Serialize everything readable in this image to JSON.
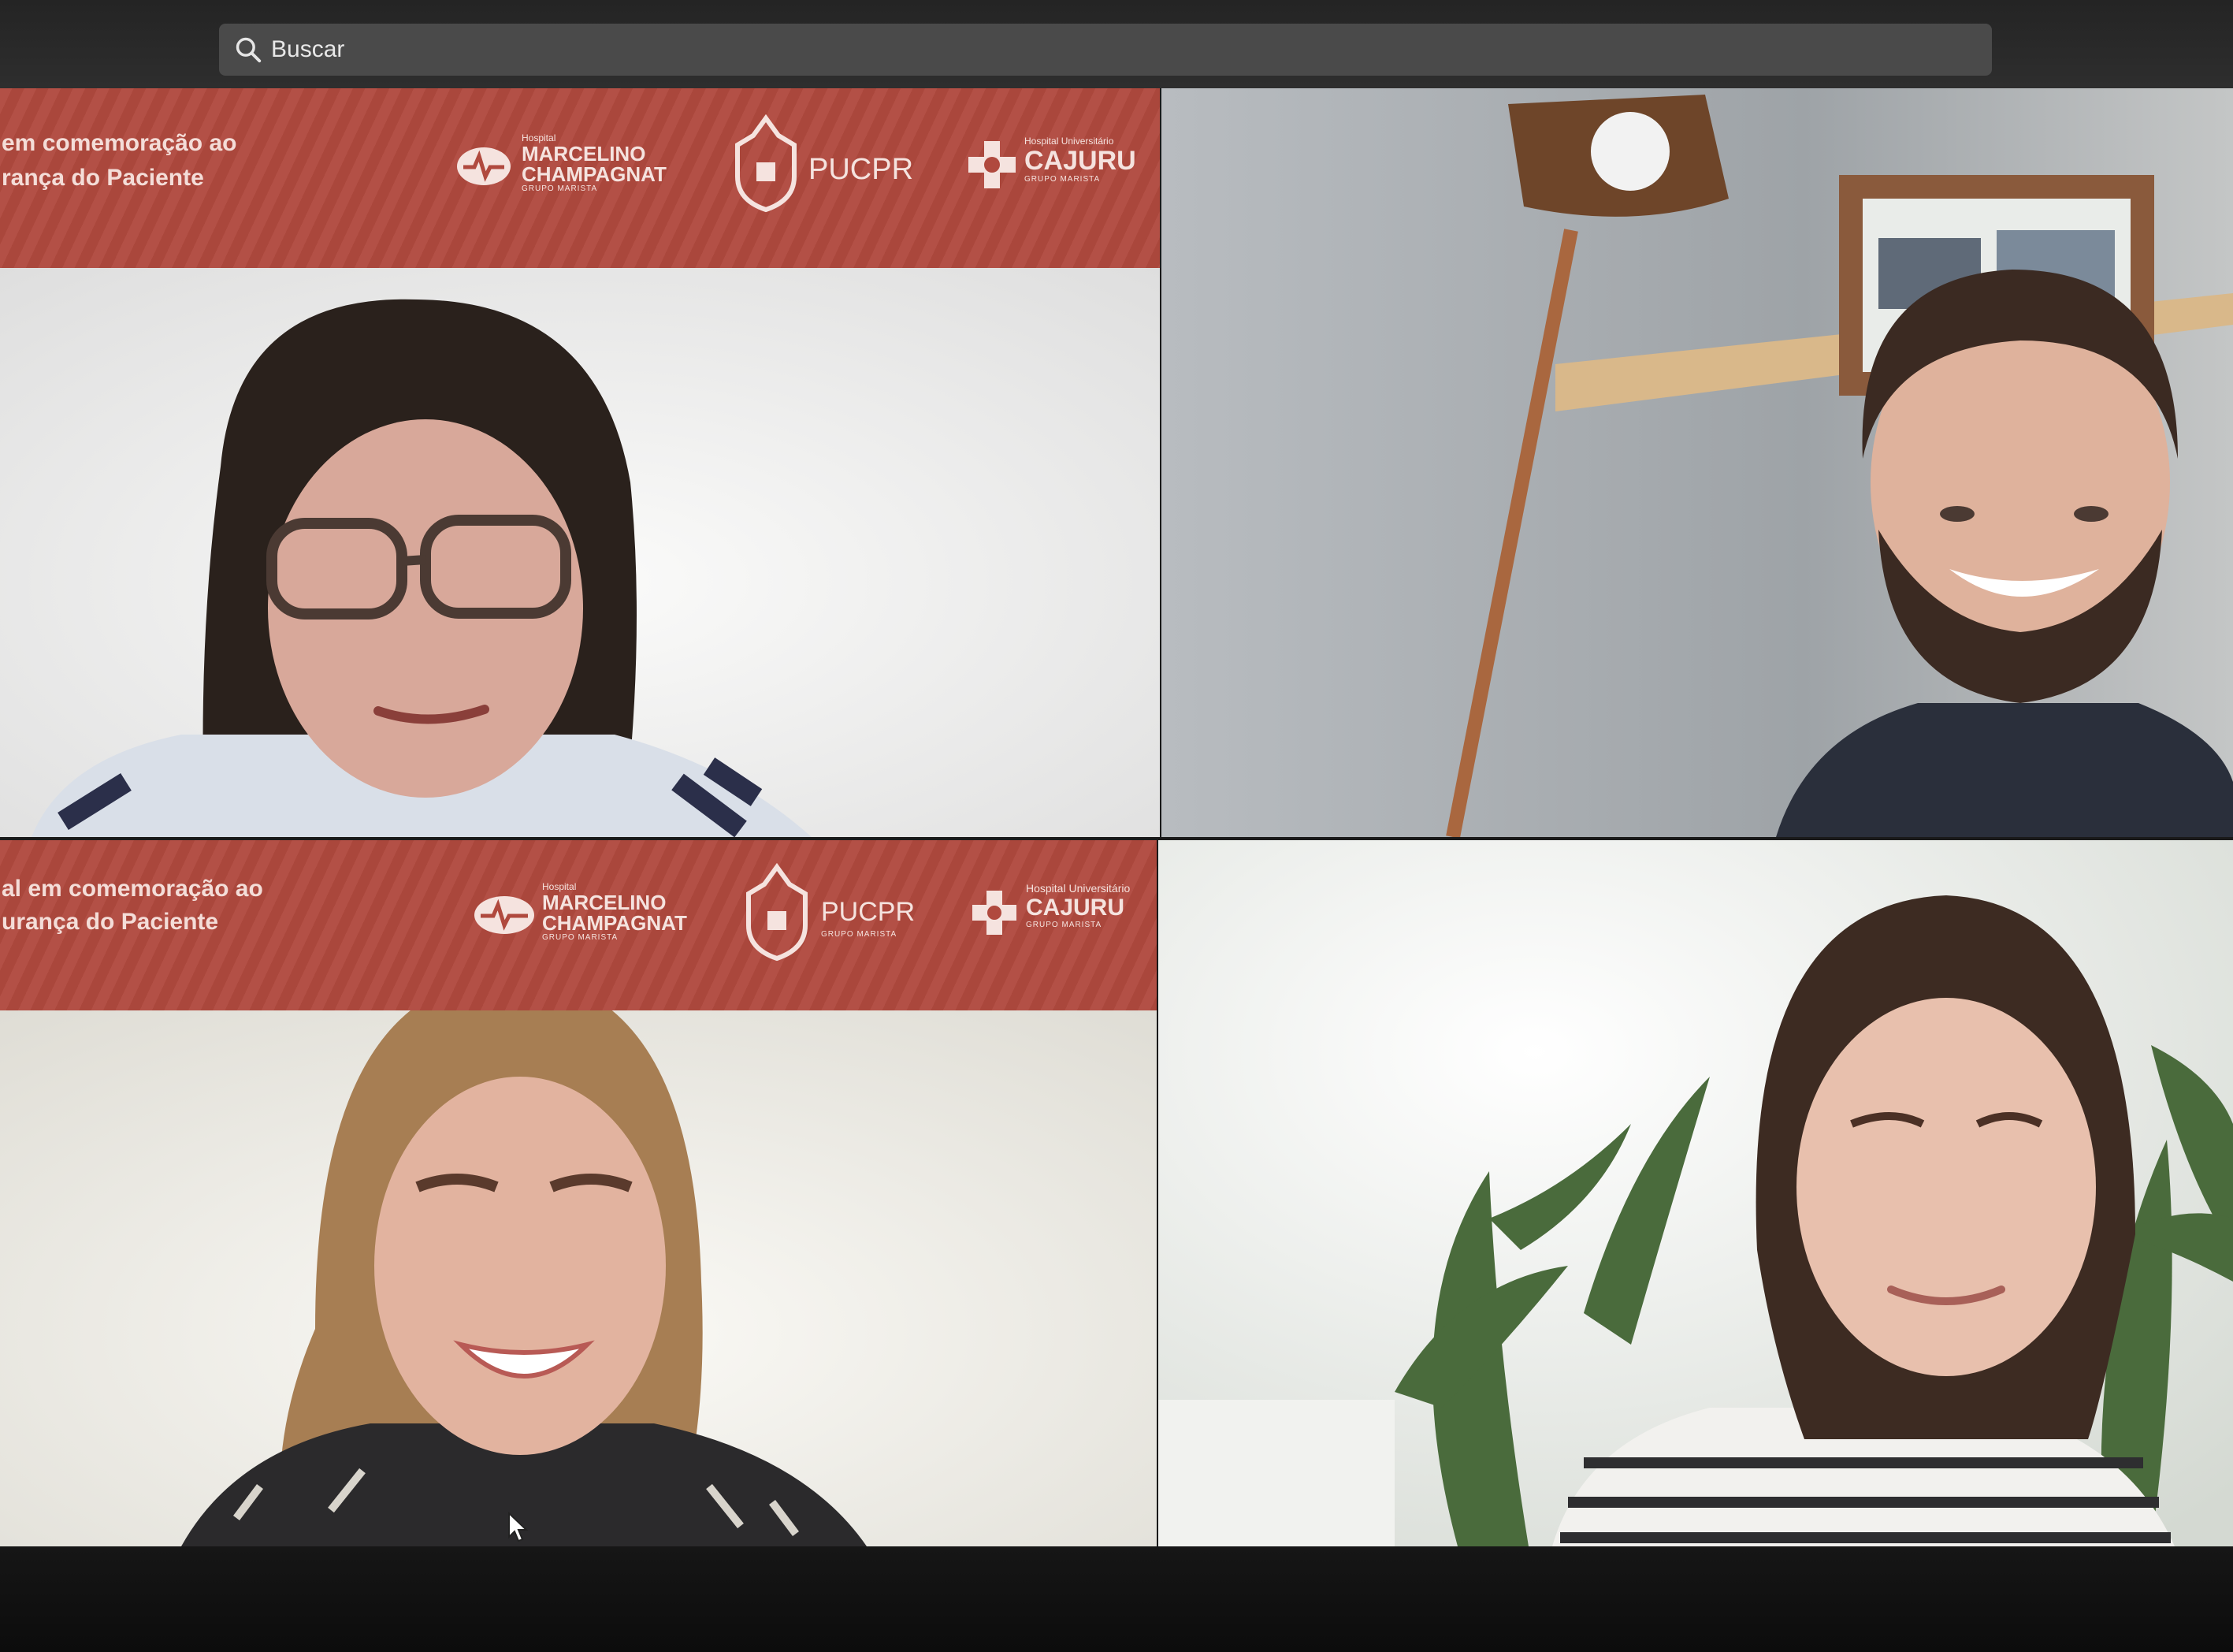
{
  "search": {
    "placeholder": "Buscar"
  },
  "banner": {
    "line1_top": "em comemoração ao",
    "line2_top": "rança do Paciente",
    "line1_bottom": "al em comemoração ao",
    "line2_bottom": "urança do Paciente"
  },
  "logos": {
    "hospital_label": "Hospital",
    "marcelino_1": "MARCELINO",
    "marcelino_2": "CHAMPAGNAT",
    "grupo": "GRUPO MARISTA",
    "pucpr": "PUCPR",
    "hospital_univ": "Hospital Universitário",
    "cajuru": "CAJURU"
  },
  "colors": {
    "banner": "#b0493e",
    "search_bg": "#4a4a4a",
    "window_bg": "#1a1a1a"
  },
  "participants_count": 4
}
